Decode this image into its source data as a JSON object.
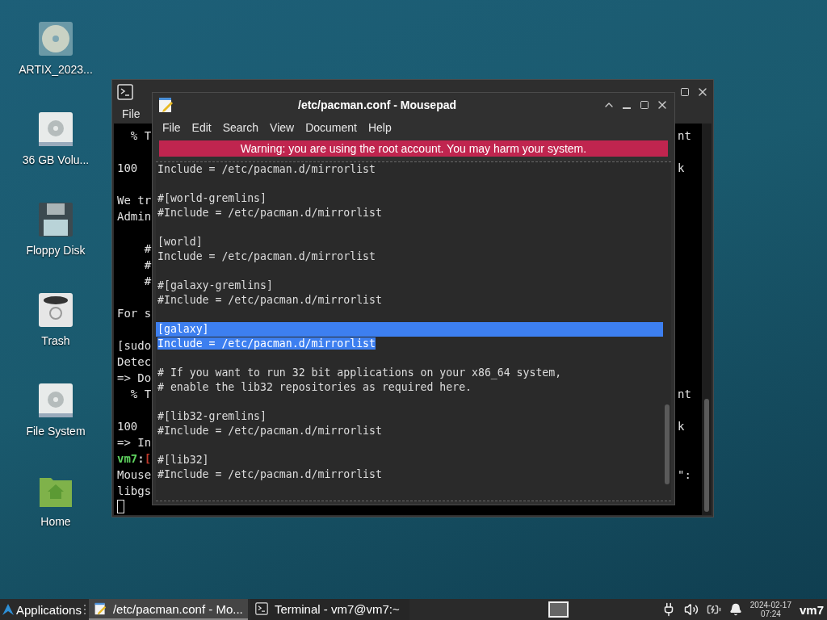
{
  "desktop_icons": [
    {
      "kind": "disc",
      "label": "ARTIX_2023..."
    },
    {
      "kind": "drive",
      "label": "36 GB Volu..."
    },
    {
      "kind": "floppy",
      "label": "Floppy Disk"
    },
    {
      "kind": "trash",
      "label": "Trash"
    },
    {
      "kind": "drive",
      "label": "File System"
    },
    {
      "kind": "home",
      "label": "Home"
    }
  ],
  "terminal": {
    "menu": [
      "File"
    ],
    "lines": [
      {
        "kind": "text",
        "parts": [
          {
            "text": "  % T"
          }
        ],
        "right": "nt"
      },
      {
        "kind": "blank"
      },
      {
        "kind": "text",
        "parts": [
          {
            "text": "100"
          }
        ],
        "right": "k"
      },
      {
        "kind": "blank"
      },
      {
        "kind": "text",
        "parts": [
          {
            "text": "We tr"
          }
        ]
      },
      {
        "kind": "text",
        "parts": [
          {
            "text": "Admin"
          }
        ]
      },
      {
        "kind": "blank"
      },
      {
        "kind": "text",
        "parts": [
          {
            "text": "    #"
          }
        ]
      },
      {
        "kind": "text",
        "parts": [
          {
            "text": "    #"
          }
        ]
      },
      {
        "kind": "text",
        "parts": [
          {
            "text": "    #"
          }
        ]
      },
      {
        "kind": "blank"
      },
      {
        "kind": "text",
        "parts": [
          {
            "text": "For s"
          }
        ]
      },
      {
        "kind": "blank"
      },
      {
        "kind": "text",
        "parts": [
          {
            "text": "[sudo"
          }
        ]
      },
      {
        "kind": "text",
        "parts": [
          {
            "text": "Detec"
          }
        ]
      },
      {
        "kind": "text",
        "parts": [
          {
            "text": "=> Do"
          }
        ]
      },
      {
        "kind": "text",
        "parts": [
          {
            "text": "  % T"
          }
        ],
        "right": "nt"
      },
      {
        "kind": "blank"
      },
      {
        "kind": "text",
        "parts": [
          {
            "text": "100"
          }
        ],
        "right": "k"
      },
      {
        "kind": "text",
        "parts": [
          {
            "text": "=> In"
          }
        ]
      },
      {
        "kind": "text",
        "parts": [
          {
            "text": "vm7",
            "color": "#5fd35f"
          },
          {
            "text": ":",
            "color": "#cfcfcf"
          },
          {
            "text": "[",
            "color": "#c0392b"
          }
        ]
      },
      {
        "kind": "text",
        "parts": [
          {
            "text": "Mouse"
          }
        ],
        "right": "\":"
      },
      {
        "kind": "text",
        "parts": [
          {
            "text": "libgs"
          }
        ]
      },
      {
        "kind": "cursor"
      }
    ]
  },
  "mousepad": {
    "title": "/etc/pacman.conf - Mousepad",
    "menu": [
      "File",
      "Edit",
      "Search",
      "View",
      "Document",
      "Help"
    ],
    "warning": "Warning: you are using the root account. You may harm your system.",
    "lines": [
      {
        "kind": "text",
        "text": "Include = /etc/pacman.d/mirrorlist",
        "selected": false
      },
      {
        "kind": "blank"
      },
      {
        "kind": "text",
        "text": "#[world-gremlins]",
        "selected": false
      },
      {
        "kind": "text",
        "text": "#Include = /etc/pacman.d/mirrorlist",
        "selected": false
      },
      {
        "kind": "blank"
      },
      {
        "kind": "text",
        "text": "[world]",
        "selected": false
      },
      {
        "kind": "text",
        "text": "Include = /etc/pacman.d/mirrorlist",
        "selected": false
      },
      {
        "kind": "blank"
      },
      {
        "kind": "text",
        "text": "#[galaxy-gremlins]",
        "selected": false
      },
      {
        "kind": "text",
        "text": "#Include = /etc/pacman.d/mirrorlist",
        "selected": false
      },
      {
        "kind": "blank"
      },
      {
        "kind": "text",
        "text": "[galaxy]",
        "selected": true
      },
      {
        "kind": "text",
        "text": "Include = /etc/pacman.d/mirrorlist",
        "selected": true
      },
      {
        "kind": "blank"
      },
      {
        "kind": "text",
        "text": "# If you want to run 32 bit applications on your x86_64 system,",
        "selected": false
      },
      {
        "kind": "text",
        "text": "# enable the lib32 repositories as required here.",
        "selected": false
      },
      {
        "kind": "blank"
      },
      {
        "kind": "text",
        "text": "#[lib32-gremlins]",
        "selected": false
      },
      {
        "kind": "text",
        "text": "#Include = /etc/pacman.d/mirrorlist",
        "selected": false
      },
      {
        "kind": "blank"
      },
      {
        "kind": "text",
        "text": "#[lib32]",
        "selected": false
      },
      {
        "kind": "text",
        "text": "#Include = /etc/pacman.d/mirrorlist",
        "selected": false
      }
    ]
  },
  "taskbar": {
    "menu_label": "Applications",
    "tasks": [
      {
        "label": "/etc/pacman.conf - Mo...",
        "kind": "editor",
        "selected": true
      },
      {
        "label": "Terminal - vm7@vm7:~",
        "kind": "terminal",
        "selected": false
      }
    ],
    "date": "2024-02-17",
    "time": "07:24",
    "user": "vm7"
  }
}
